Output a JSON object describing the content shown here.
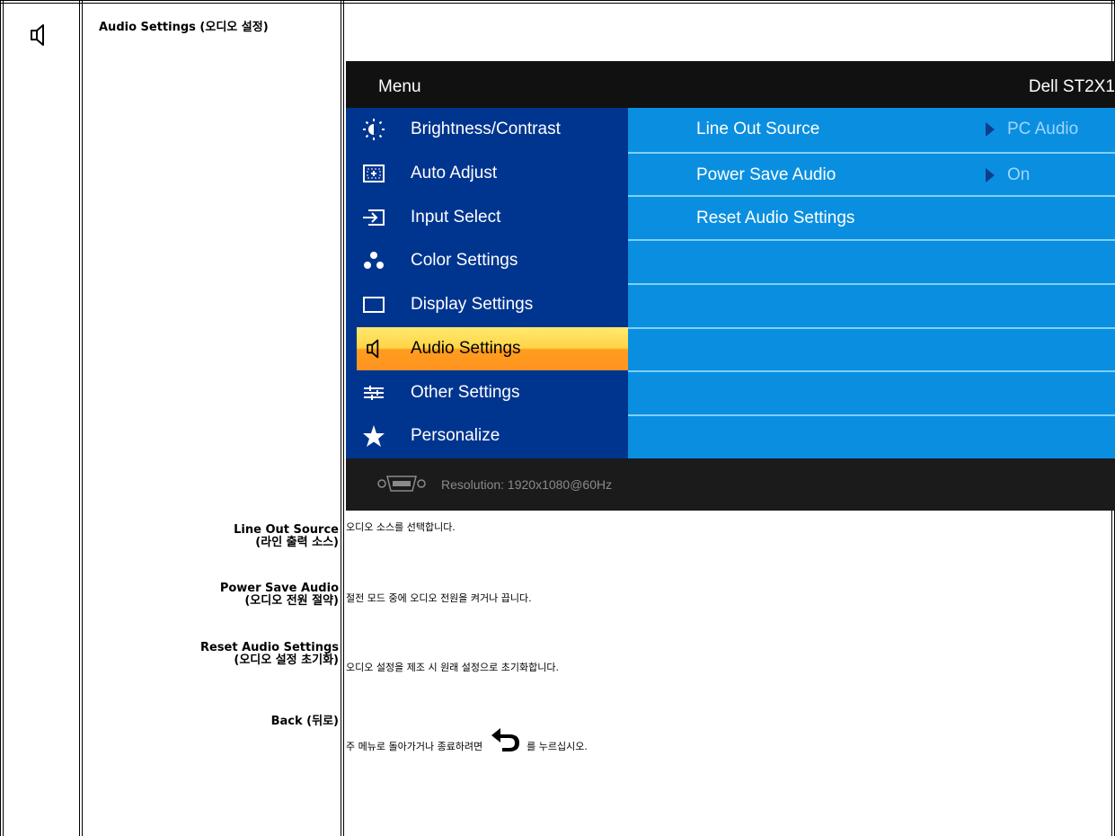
{
  "section": {
    "title": "Audio Settings (오디오 설정)"
  },
  "osd": {
    "menu_title": "Menu",
    "model": "Dell ST2X1",
    "left_items": [
      {
        "label": "Brightness/Contrast",
        "icon": "brightness-icon"
      },
      {
        "label": "Auto Adjust",
        "icon": "auto-adjust-icon"
      },
      {
        "label": "Input Select",
        "icon": "input-select-icon"
      },
      {
        "label": "Color Settings",
        "icon": "color-settings-icon"
      },
      {
        "label": "Display Settings",
        "icon": "display-settings-icon"
      },
      {
        "label": "Audio Settings",
        "icon": "speaker-icon"
      },
      {
        "label": "Other Settings",
        "icon": "sliders-icon"
      },
      {
        "label": "Personalize",
        "icon": "star-icon"
      }
    ],
    "selected_index": 5,
    "right_rows": [
      {
        "label": "Line Out Source",
        "value": "PC Audio"
      },
      {
        "label": "Power Save Audio",
        "value": "On"
      },
      {
        "label": "Reset Audio Settings",
        "value": ""
      }
    ],
    "resolution": "Resolution: 1920x1080@60Hz",
    "colors": {
      "left_panel": "#00358f",
      "right_panel": "#0a8fe0",
      "selected": "#ffb733"
    }
  },
  "descriptions": [
    {
      "term_en": "Line Out Source",
      "term_ko": "(라인 출력 소스)",
      "text": "오디오 소스를 선택합니다."
    },
    {
      "term_en": "Power Save Audio",
      "term_ko": "(오디오 전원 절약)",
      "text": "절전 모드 중에 오디오 전원을 켜거나 끕니다."
    },
    {
      "term_en": "Reset Audio Settings",
      "term_ko": "(오디오 설정 초기화)",
      "text": "오디오 설정을 제조 시 원래 설정으로 초기화합니다."
    },
    {
      "term_en": "Back (뒤로)",
      "term_ko": "",
      "text_before": "주 메뉴로 돌아가거나 종료하려면",
      "text_after": "를 누르십시오."
    }
  ]
}
